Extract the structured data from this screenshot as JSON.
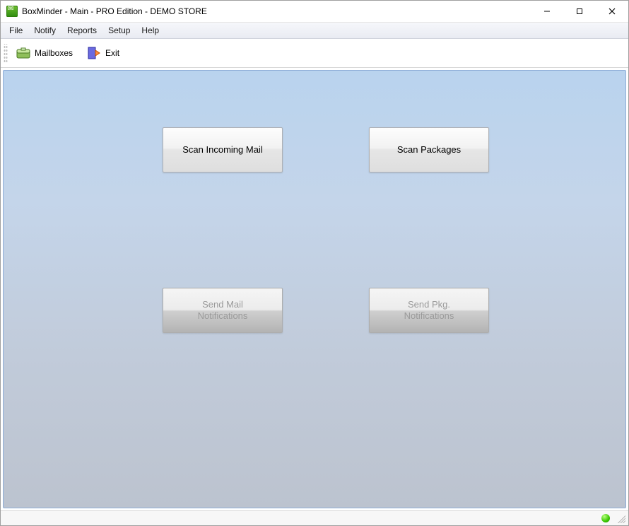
{
  "window": {
    "title": "BoxMinder - Main - PRO Edition - DEMO STORE"
  },
  "menu": {
    "items": [
      "File",
      "Notify",
      "Reports",
      "Setup",
      "Help"
    ]
  },
  "toolbar": {
    "mailboxes_label": "Mailboxes",
    "exit_label": "Exit"
  },
  "main": {
    "scan_mail_label": "Scan Incoming Mail",
    "scan_packages_label": "Scan Packages",
    "send_mail_line1": "Send Mail",
    "send_mail_line2": "Notifications",
    "send_pkg_line1": "Send Pkg.",
    "send_pkg_line2": "Notifications"
  },
  "status": {
    "indicator": "online"
  }
}
